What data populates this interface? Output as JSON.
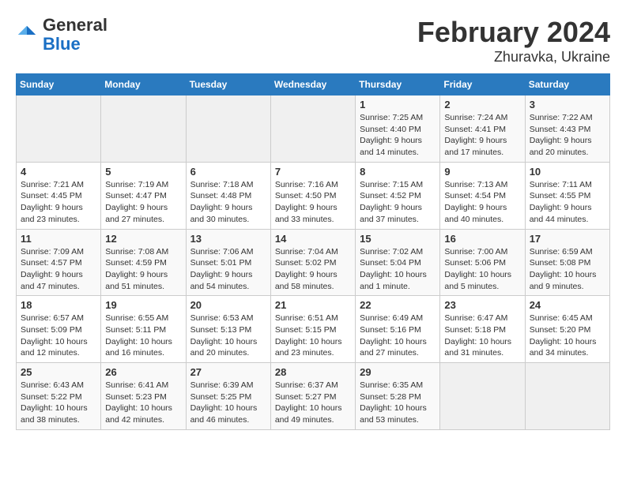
{
  "header": {
    "logo": {
      "general": "General",
      "blue": "Blue"
    },
    "title": "February 2024",
    "subtitle": "Zhuravka, Ukraine"
  },
  "days_of_week": [
    "Sunday",
    "Monday",
    "Tuesday",
    "Wednesday",
    "Thursday",
    "Friday",
    "Saturday"
  ],
  "weeks": [
    [
      {
        "day": "",
        "detail": ""
      },
      {
        "day": "",
        "detail": ""
      },
      {
        "day": "",
        "detail": ""
      },
      {
        "day": "",
        "detail": ""
      },
      {
        "day": "1",
        "detail": "Sunrise: 7:25 AM\nSunset: 4:40 PM\nDaylight: 9 hours\nand 14 minutes."
      },
      {
        "day": "2",
        "detail": "Sunrise: 7:24 AM\nSunset: 4:41 PM\nDaylight: 9 hours\nand 17 minutes."
      },
      {
        "day": "3",
        "detail": "Sunrise: 7:22 AM\nSunset: 4:43 PM\nDaylight: 9 hours\nand 20 minutes."
      }
    ],
    [
      {
        "day": "4",
        "detail": "Sunrise: 7:21 AM\nSunset: 4:45 PM\nDaylight: 9 hours\nand 23 minutes."
      },
      {
        "day": "5",
        "detail": "Sunrise: 7:19 AM\nSunset: 4:47 PM\nDaylight: 9 hours\nand 27 minutes."
      },
      {
        "day": "6",
        "detail": "Sunrise: 7:18 AM\nSunset: 4:48 PM\nDaylight: 9 hours\nand 30 minutes."
      },
      {
        "day": "7",
        "detail": "Sunrise: 7:16 AM\nSunset: 4:50 PM\nDaylight: 9 hours\nand 33 minutes."
      },
      {
        "day": "8",
        "detail": "Sunrise: 7:15 AM\nSunset: 4:52 PM\nDaylight: 9 hours\nand 37 minutes."
      },
      {
        "day": "9",
        "detail": "Sunrise: 7:13 AM\nSunset: 4:54 PM\nDaylight: 9 hours\nand 40 minutes."
      },
      {
        "day": "10",
        "detail": "Sunrise: 7:11 AM\nSunset: 4:55 PM\nDaylight: 9 hours\nand 44 minutes."
      }
    ],
    [
      {
        "day": "11",
        "detail": "Sunrise: 7:09 AM\nSunset: 4:57 PM\nDaylight: 9 hours\nand 47 minutes."
      },
      {
        "day": "12",
        "detail": "Sunrise: 7:08 AM\nSunset: 4:59 PM\nDaylight: 9 hours\nand 51 minutes."
      },
      {
        "day": "13",
        "detail": "Sunrise: 7:06 AM\nSunset: 5:01 PM\nDaylight: 9 hours\nand 54 minutes."
      },
      {
        "day": "14",
        "detail": "Sunrise: 7:04 AM\nSunset: 5:02 PM\nDaylight: 9 hours\nand 58 minutes."
      },
      {
        "day": "15",
        "detail": "Sunrise: 7:02 AM\nSunset: 5:04 PM\nDaylight: 10 hours\nand 1 minute."
      },
      {
        "day": "16",
        "detail": "Sunrise: 7:00 AM\nSunset: 5:06 PM\nDaylight: 10 hours\nand 5 minutes."
      },
      {
        "day": "17",
        "detail": "Sunrise: 6:59 AM\nSunset: 5:08 PM\nDaylight: 10 hours\nand 9 minutes."
      }
    ],
    [
      {
        "day": "18",
        "detail": "Sunrise: 6:57 AM\nSunset: 5:09 PM\nDaylight: 10 hours\nand 12 minutes."
      },
      {
        "day": "19",
        "detail": "Sunrise: 6:55 AM\nSunset: 5:11 PM\nDaylight: 10 hours\nand 16 minutes."
      },
      {
        "day": "20",
        "detail": "Sunrise: 6:53 AM\nSunset: 5:13 PM\nDaylight: 10 hours\nand 20 minutes."
      },
      {
        "day": "21",
        "detail": "Sunrise: 6:51 AM\nSunset: 5:15 PM\nDaylight: 10 hours\nand 23 minutes."
      },
      {
        "day": "22",
        "detail": "Sunrise: 6:49 AM\nSunset: 5:16 PM\nDaylight: 10 hours\nand 27 minutes."
      },
      {
        "day": "23",
        "detail": "Sunrise: 6:47 AM\nSunset: 5:18 PM\nDaylight: 10 hours\nand 31 minutes."
      },
      {
        "day": "24",
        "detail": "Sunrise: 6:45 AM\nSunset: 5:20 PM\nDaylight: 10 hours\nand 34 minutes."
      }
    ],
    [
      {
        "day": "25",
        "detail": "Sunrise: 6:43 AM\nSunset: 5:22 PM\nDaylight: 10 hours\nand 38 minutes."
      },
      {
        "day": "26",
        "detail": "Sunrise: 6:41 AM\nSunset: 5:23 PM\nDaylight: 10 hours\nand 42 minutes."
      },
      {
        "day": "27",
        "detail": "Sunrise: 6:39 AM\nSunset: 5:25 PM\nDaylight: 10 hours\nand 46 minutes."
      },
      {
        "day": "28",
        "detail": "Sunrise: 6:37 AM\nSunset: 5:27 PM\nDaylight: 10 hours\nand 49 minutes."
      },
      {
        "day": "29",
        "detail": "Sunrise: 6:35 AM\nSunset: 5:28 PM\nDaylight: 10 hours\nand 53 minutes."
      },
      {
        "day": "",
        "detail": ""
      },
      {
        "day": "",
        "detail": ""
      }
    ]
  ]
}
